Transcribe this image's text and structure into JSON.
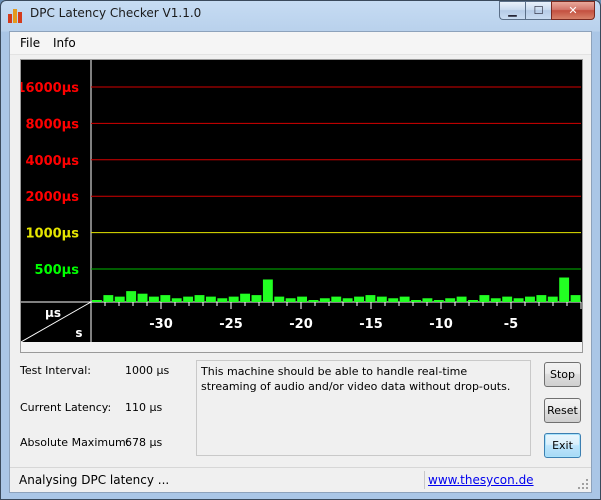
{
  "window": {
    "title": "DPC Latency Checker V1.1.0"
  },
  "menu": {
    "file": "File",
    "info": "Info"
  },
  "icons": {
    "app": "app-bar-chart-icon",
    "minimize": "minimize-icon",
    "maximize": "maximize-icon",
    "close": "close-icon",
    "grip": "resize-grip-icon"
  },
  "colors": {
    "red_line": "#d40000",
    "yellow_line": "#e6e600",
    "green_line": "#00b800",
    "bar_green": "#22ff22",
    "plot_bg": "#000000"
  },
  "chart_data": {
    "type": "bar",
    "title": "",
    "y_labels": [
      "16000µs",
      "8000µs",
      "4000µs",
      "2000µs",
      "1000µs",
      "500µs"
    ],
    "y_label_levels": [
      16000,
      8000,
      4000,
      2000,
      1000,
      500
    ],
    "y_label_colors": [
      "#ff0000",
      "#ff0000",
      "#ff0000",
      "#ff0000",
      "#e6e600",
      "#00ff00"
    ],
    "corner_top": "µs",
    "corner_bottom": "s",
    "x_ticks": [
      "-30",
      "-25",
      "-20",
      "-15",
      "-10",
      "-5"
    ],
    "x_tick_values": [
      -30,
      -25,
      -20,
      -15,
      -10,
      -5
    ],
    "x_range": [
      -35,
      0
    ],
    "values": [
      110,
      140,
      130,
      170,
      150,
      130,
      140,
      120,
      130,
      140,
      130,
      120,
      130,
      150,
      140,
      300,
      130,
      120,
      130,
      110,
      120,
      130,
      120,
      130,
      140,
      130,
      120,
      130,
      110,
      120,
      110,
      120,
      130,
      110,
      140,
      120,
      130,
      120,
      130,
      140,
      130,
      330,
      140
    ]
  },
  "info": {
    "test_interval_label": "Test Interval:",
    "test_interval_value": "1000 µs",
    "current_latency_label": "Current Latency:",
    "current_latency_value": "110 µs",
    "absolute_maximum_label": "Absolute Maximum:",
    "absolute_maximum_value": "678 µs",
    "message": "This machine should be able to handle real-time streaming of audio and/or video data without drop-outs."
  },
  "buttons": {
    "stop": "Stop",
    "reset": "Reset",
    "exit": "Exit"
  },
  "status": {
    "text": "Analysing DPC latency ...",
    "link": "www.thesycon.de"
  }
}
